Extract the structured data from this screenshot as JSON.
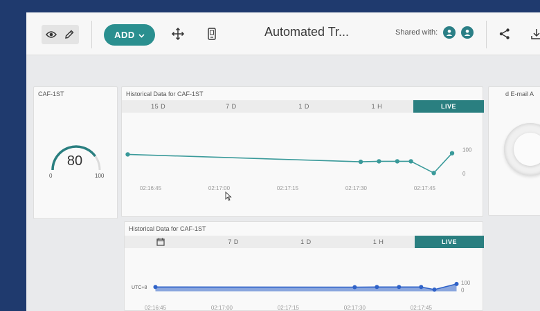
{
  "toolbar": {
    "add_label": "ADD",
    "title": "Automated Tr...",
    "shared_with_label": "Shared with:"
  },
  "gauge_widget": {
    "title": "CAF-1ST",
    "value": "80",
    "min_label": "0",
    "max_label": "100",
    "value_fraction": 0.8,
    "color": "#2a7f80"
  },
  "chart1": {
    "title": "Historical Data for CAF-1ST",
    "tabs": [
      "15 D",
      "7 D",
      "1 D",
      "1 H",
      "LIVE"
    ],
    "active_tab": "LIVE"
  },
  "chart2": {
    "title": "Historical Data for CAF-1ST",
    "tabs": [
      "7 D",
      "1 D",
      "1 H",
      "LIVE"
    ],
    "active_tab": "LIVE",
    "timezone_label": "UTC+8"
  },
  "email_widget": {
    "title_fragment": "d E-mail A"
  },
  "chart_data": [
    {
      "type": "line",
      "title": "Historical Data for CAF-1ST",
      "x": [
        "02:16:40",
        "02:17:31",
        "02:17:35",
        "02:17:39",
        "02:17:42",
        "02:17:47",
        "02:17:51"
      ],
      "values": [
        80,
        49,
        51,
        51,
        51,
        2,
        85
      ],
      "x_tick_labels": [
        "02:16:45",
        "02:17:00",
        "02:17:15",
        "02:17:30",
        "02:17:45"
      ],
      "y_tick_labels": [
        "100",
        "0"
      ],
      "ylim": [
        0,
        100
      ],
      "grid": false,
      "color": "#3a9a9a"
    },
    {
      "type": "area",
      "title": "Historical Data for CAF-1ST",
      "x": [
        "02:16:45",
        "02:17:30",
        "02:17:35",
        "02:17:40",
        "02:17:45",
        "02:17:48",
        "02:17:53"
      ],
      "values": [
        40,
        38,
        40,
        40,
        40,
        5,
        82
      ],
      "x_tick_labels": [
        "02:16:45",
        "02:17:00",
        "02:17:15",
        "02:17:30",
        "02:17:45"
      ],
      "y_tick_labels": [
        "100",
        "0"
      ],
      "ylim": [
        0,
        100
      ],
      "grid": false,
      "color": "#2f62c8"
    }
  ]
}
